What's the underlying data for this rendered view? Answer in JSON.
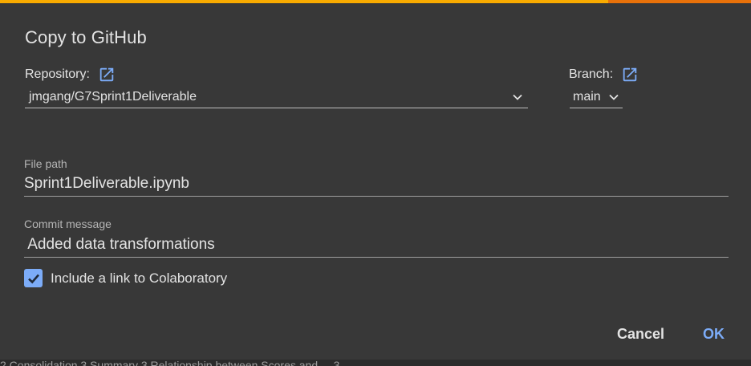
{
  "progress": {
    "fraction": 0.81,
    "track_color": "#e8710a",
    "fill_color": "#f9ab00"
  },
  "dialog": {
    "title": "Copy to GitHub",
    "repository": {
      "label": "Repository:",
      "open_icon": "open-in-new-icon",
      "selected": "jmgang/G7Sprint1Deliverable"
    },
    "branch": {
      "label": "Branch:",
      "open_icon": "open-in-new-icon",
      "selected": "main"
    },
    "file_path": {
      "label": "File path",
      "value": "Sprint1Deliverable.ipynb"
    },
    "commit_message": {
      "label": "Commit message",
      "value": " Added data transformations"
    },
    "include_link": {
      "label": "Include a link to Colaboratory",
      "checked": true
    },
    "buttons": {
      "cancel": "Cancel",
      "ok": "OK"
    },
    "accent_color": "#7cacf8"
  },
  "background": {
    "text": "2 Consolidation 3 Summary 3 Relationship between Scores and ... 3"
  }
}
